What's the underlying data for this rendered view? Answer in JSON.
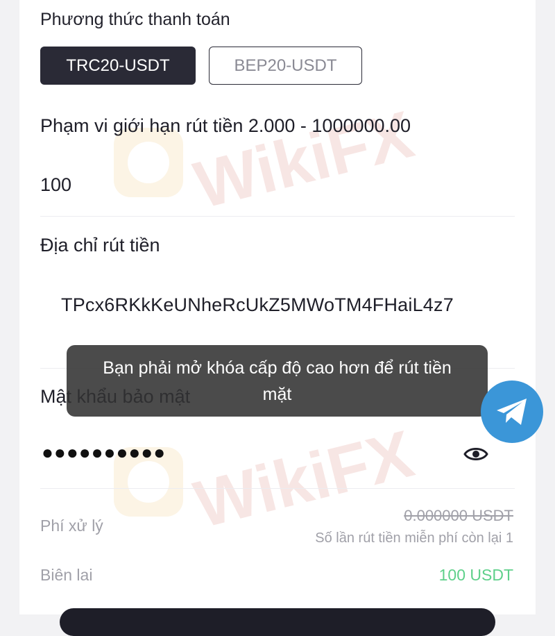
{
  "payment_method": {
    "title": "Phương thức thanh toán",
    "options": [
      "TRC20-USDT",
      "BEP20-USDT"
    ],
    "selected": "TRC20-USDT"
  },
  "withdraw": {
    "limit_text": "Phạm vi giới hạn rút tiền 2.000 - 1000000.00",
    "amount": "100"
  },
  "address": {
    "label": "Địa chỉ rút tiền",
    "value": "TPcx6RKkKeUNheRcUkZ5MWoTM4FHaiL4z7"
  },
  "password": {
    "label": "Mật khẩu bảo mật",
    "masked_value": "●●●●●●●●●●"
  },
  "fee": {
    "label": "Phí xử lý",
    "value": "0.000000 USDT",
    "free_withdrawals_text": "Số lần rút tiền miễn phí còn lại 1"
  },
  "receipt": {
    "label": "Biên lai",
    "value": "100 USDT"
  },
  "toast": {
    "line1": "Bạn phải mở khóa cấp độ cao hơn để rút tiền",
    "line2": "mặt"
  },
  "watermark": {
    "text": "WikiFX"
  },
  "colors": {
    "primary_dark": "#2a2a36",
    "receipt_green": "#5ed08a",
    "telegram_blue": "#3b96d8",
    "muted": "#a0a0a8"
  }
}
